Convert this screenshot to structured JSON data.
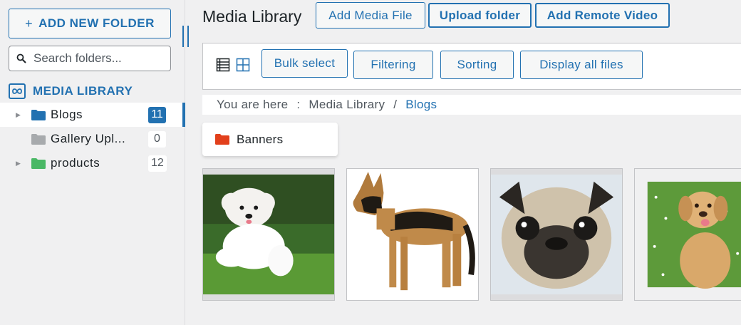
{
  "sidebar": {
    "add_folder_label": "ADD NEW FOLDER",
    "add_folder_icon": "plus-icon",
    "search_placeholder": "Search folders...",
    "library_label": "MEDIA LIBRARY",
    "folders": [
      {
        "name": "Blogs",
        "count": "11",
        "color": "#2271b1",
        "active": true,
        "has_children": true
      },
      {
        "name": "Gallery Upl...",
        "count": "0",
        "color": "#a7aaad",
        "active": false,
        "has_children": false
      },
      {
        "name": "products",
        "count": "12",
        "color": "#4ab866",
        "active": false,
        "has_children": true
      }
    ]
  },
  "header": {
    "title": "Media Library",
    "buttons": {
      "add_media": "Add Media File",
      "upload_folder": "Upload folder",
      "add_remote_video": "Add Remote Video"
    }
  },
  "toolbar": {
    "view_icons": [
      "list-view-icon",
      "grid-view-icon"
    ],
    "bulk_select": "Bulk select",
    "filtering": "Filtering",
    "sorting": "Sorting",
    "display_all": "Display all files"
  },
  "breadcrumb": {
    "prefix": "You are here",
    "separator_colon": ":",
    "root": "Media Library",
    "separator_slash": "/",
    "current": "Blogs"
  },
  "subfolders": [
    {
      "name": "Banners",
      "color": "#e2401c"
    }
  ],
  "media_items": [
    {
      "icon": "white-dog-photo"
    },
    {
      "icon": "german-shepherd-photo"
    },
    {
      "icon": "pug-photo"
    },
    {
      "icon": "labrador-puppy-photo"
    }
  ],
  "colors": {
    "accent": "#2271b1",
    "folder_blue": "#2271b1",
    "folder_grey": "#a7aaad",
    "folder_green": "#4ab866",
    "folder_red": "#e2401c"
  }
}
